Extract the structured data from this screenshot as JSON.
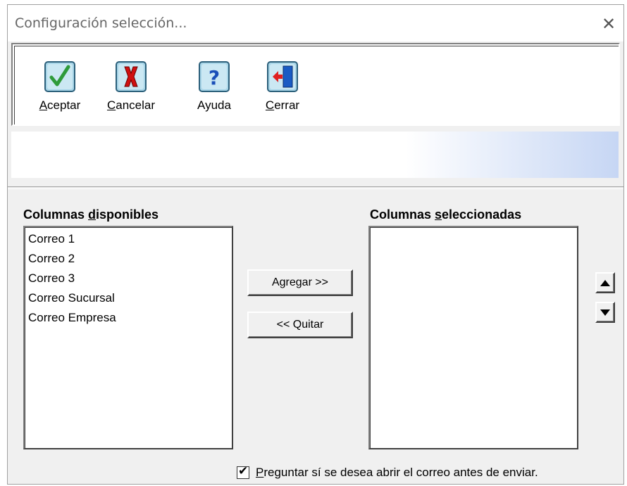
{
  "window": {
    "title": "Configuración selección...",
    "close_glyph": "✕"
  },
  "toolbar": {
    "buttons": [
      {
        "label_pre": "",
        "label_accel": "A",
        "label_rest": "ceptar",
        "icon": "checkmark-icon"
      },
      {
        "label_pre": "",
        "label_accel": "C",
        "label_rest": "ancelar",
        "icon": "x-cancel-icon"
      },
      {
        "label_pre": "Ayuda",
        "label_accel": "",
        "label_rest": "",
        "icon": "question-help-icon"
      },
      {
        "label_pre": "",
        "label_accel": "C",
        "label_rest": "errar",
        "icon": "exit-door-icon"
      }
    ]
  },
  "available": {
    "label_pre": "Columnas ",
    "label_accel": "d",
    "label_rest": "isponibles",
    "items": [
      "Correo 1",
      "Correo 2",
      "Correo 3",
      "Correo Sucursal",
      "Correo Empresa"
    ]
  },
  "selected": {
    "label_pre": "Columnas ",
    "label_accel": "s",
    "label_rest": "eleccionadas",
    "items": []
  },
  "actions": {
    "add_label": "Agregar >>",
    "remove_label": "<< Quitar"
  },
  "option": {
    "checked": true,
    "check_glyph": "✔",
    "label_accel": "P",
    "label_rest": "reguntar sí se desea abrir el correo antes de enviar."
  },
  "colors": {
    "accept_green": "#2e9b3a",
    "cancel_red": "#d01010",
    "help_blue": "#1a4fb8",
    "banner_gradient_end": "#c6d6f4"
  }
}
